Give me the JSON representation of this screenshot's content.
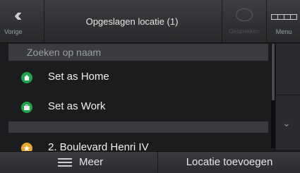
{
  "header": {
    "back_label": "Vorige",
    "back_icon": "double-chevron-left-icon",
    "title": "Opgeslagen locatie (1)",
    "disabled_label": "Gesprekken",
    "menu_label": "Menu"
  },
  "search": {
    "placeholder": "Zoeken op naam"
  },
  "list": {
    "items": [
      {
        "label": "Set as Home",
        "icon": "home-icon",
        "color": "#1aa64a"
      },
      {
        "label": "Set as Work",
        "icon": "briefcase-icon",
        "color": "#1aa64a"
      },
      {
        "label": "2. Boulevard Henri IV",
        "icon": "star-icon",
        "color": "#e7a82b"
      }
    ]
  },
  "footer": {
    "more_label": "Meer",
    "add_label": "Locatie toevoegen"
  }
}
